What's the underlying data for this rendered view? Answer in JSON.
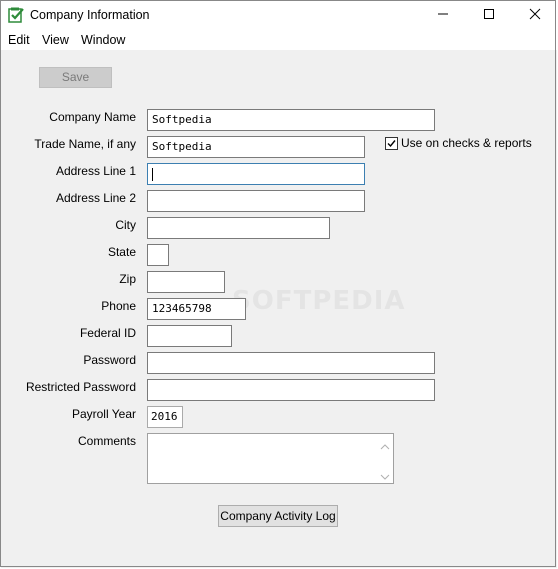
{
  "window": {
    "title": "Company Information",
    "minimize_icon": "minimize-icon",
    "maximize_icon": "maximize-icon",
    "close_icon": "close-icon"
  },
  "menu": {
    "items": [
      "Edit",
      "View",
      "Window"
    ]
  },
  "toolbar": {
    "save_label": "Save"
  },
  "form": {
    "company_name": {
      "label": "Company Name",
      "value": "Softpedia"
    },
    "trade_name": {
      "label": "Trade Name, if any",
      "value": "Softpedia"
    },
    "use_on_checks": {
      "label": "Use on checks & reports",
      "checked": true
    },
    "address1": {
      "label": "Address Line 1",
      "value": ""
    },
    "address2": {
      "label": "Address Line 2",
      "value": ""
    },
    "city": {
      "label": "City",
      "value": ""
    },
    "state": {
      "label": "State",
      "value": ""
    },
    "zip": {
      "label": "Zip",
      "value": ""
    },
    "phone": {
      "label": "Phone",
      "value": "123465798"
    },
    "federal_id": {
      "label": "Federal ID",
      "value": ""
    },
    "password": {
      "label": "Password",
      "value": ""
    },
    "restricted_password": {
      "label": "Restricted Password",
      "value": ""
    },
    "payroll_year": {
      "label": "Payroll Year",
      "value": "2016"
    },
    "comments": {
      "label": "Comments",
      "value": ""
    }
  },
  "buttons": {
    "activity_log": "Company Activity Log"
  },
  "watermark": "SOFTPEDIA",
  "colors": {
    "client_bg": "#f0f0f0",
    "focus_border": "#3c7fb1",
    "app_icon": "#2e8b3a"
  }
}
